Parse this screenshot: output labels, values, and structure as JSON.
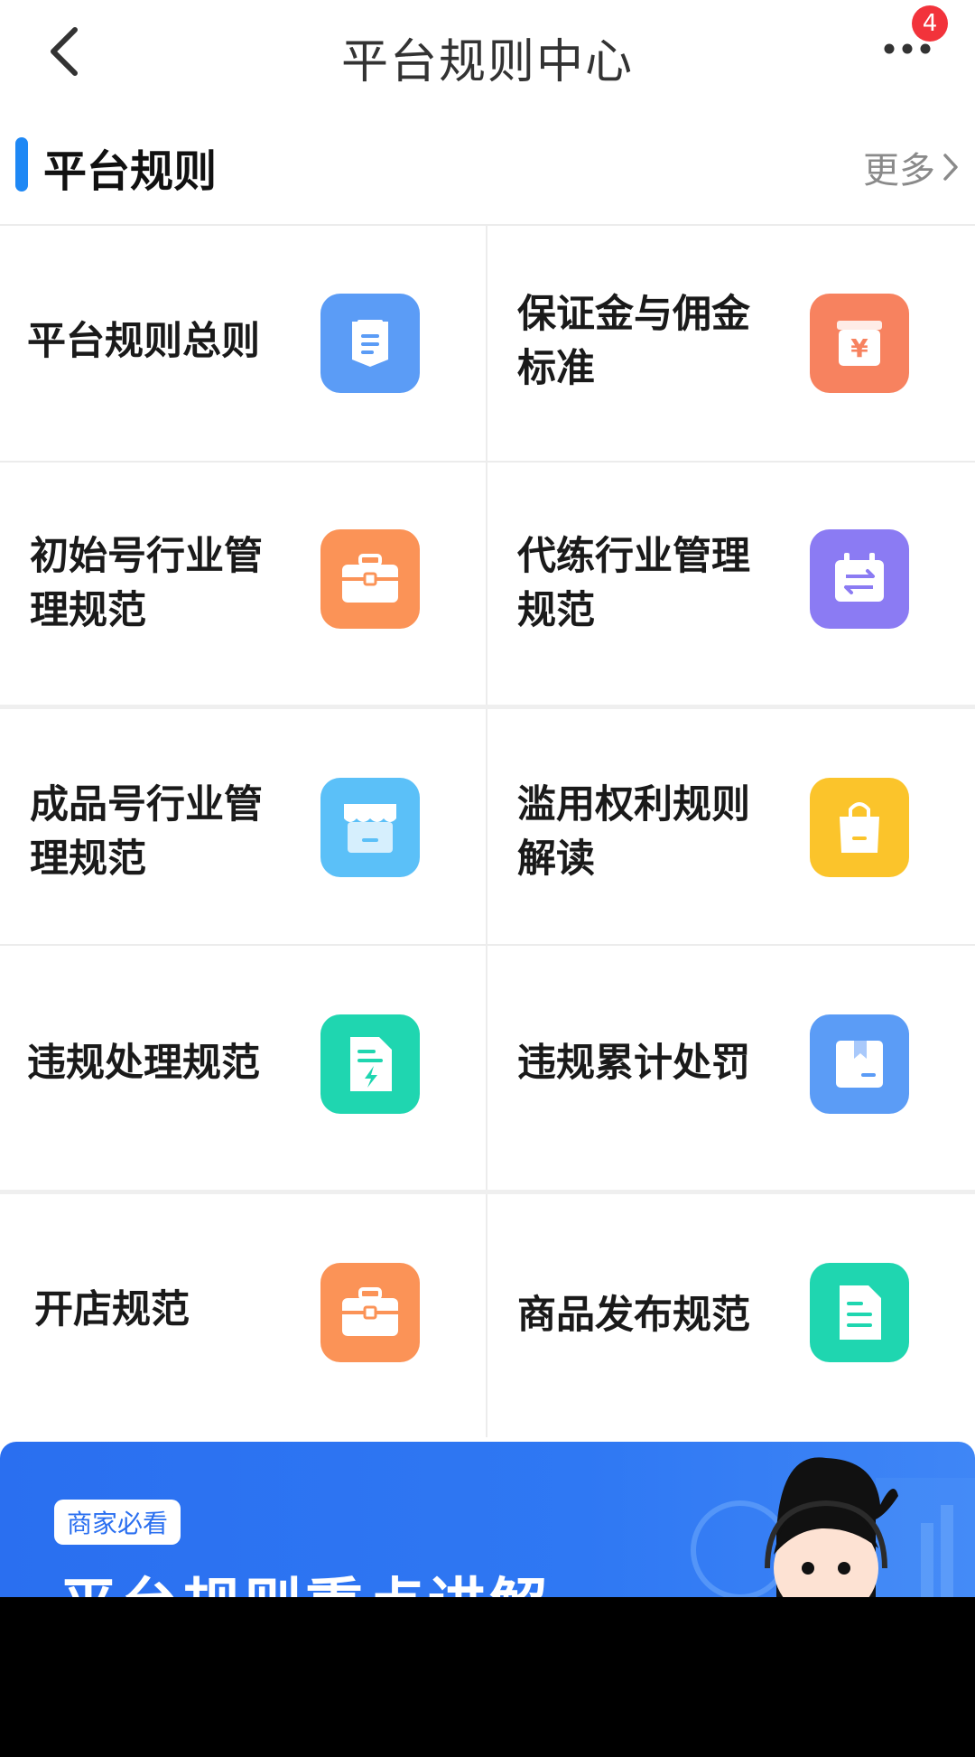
{
  "header": {
    "title": "平台规则中心",
    "notification_count": "4"
  },
  "section": {
    "title": "平台规则",
    "more_label": "更多"
  },
  "rules": [
    {
      "label": "平台规则总则",
      "icon": "document-icon",
      "color": "#5b9cf6"
    },
    {
      "label": "保证金与佣金标准",
      "icon": "money-box-icon",
      "color": "#f7825f"
    },
    {
      "label": "初始号行业管理规范",
      "icon": "briefcase-icon",
      "color": "#fb9357"
    },
    {
      "label": "代练行业管理规范",
      "icon": "exchange-icon",
      "color": "#8b7bf3"
    },
    {
      "label": "成品号行业管理规范",
      "icon": "store-icon",
      "color": "#5bc0f8"
    },
    {
      "label": "滥用权利规则解读",
      "icon": "shopping-bag-icon",
      "color": "#fbc42b"
    },
    {
      "label": "违规处理规范",
      "icon": "lightning-file-icon",
      "color": "#1fd6b0"
    },
    {
      "label": "违规累计处罚",
      "icon": "bookmark-box-icon",
      "color": "#5b9cf6"
    },
    {
      "label": "开店规范",
      "icon": "briefcase-icon",
      "color": "#fb9357"
    },
    {
      "label": "商品发布规范",
      "icon": "file-icon",
      "color": "#1fd6b0"
    }
  ],
  "banner": {
    "tag": "商家必看",
    "title": "平台规则重点讲解"
  },
  "colors": {
    "accent": "#1e88f5",
    "badge": "#f2333b",
    "banner": "#2a6ff0"
  }
}
